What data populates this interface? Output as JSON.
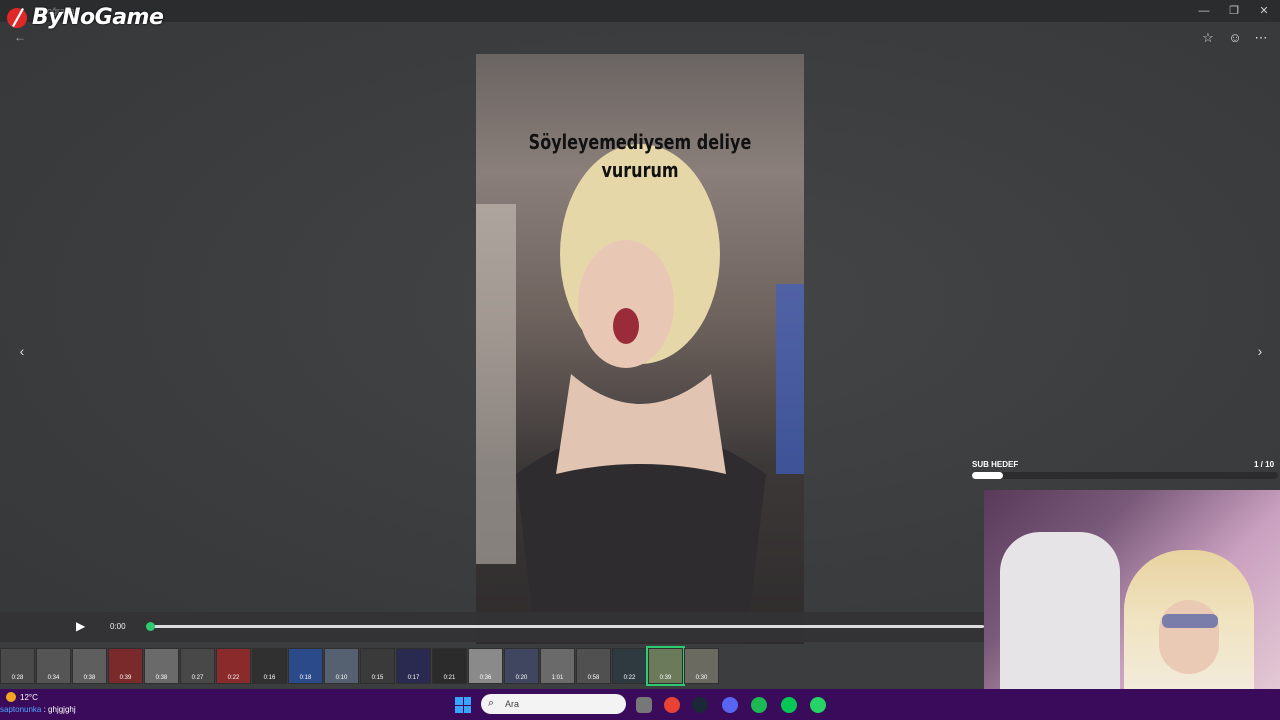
{
  "app": {
    "logo_text": "ByNoGame",
    "window_title": "Fotoğraflar"
  },
  "window_controls": {
    "minimize": "—",
    "restore": "❐",
    "close": "✕"
  },
  "viewer": {
    "back_icon": "arrow-left-icon",
    "top_icons": [
      "star-icon",
      "smiley-icon",
      "more-icon"
    ],
    "caption_line1": "Söyleyemediysem deliye",
    "caption_line2": "vururum",
    "prev_icon": "chevron-left-icon",
    "next_icon": "chevron-right-icon"
  },
  "player": {
    "time": "0:00",
    "progress": 0.0
  },
  "thumbnails": [
    "0:28",
    "0:34",
    "0:38",
    "0:39",
    "0:38",
    "0:27",
    "0:22",
    "0:16",
    "0:18",
    "0:10",
    "0:15",
    "0:17",
    "0:21",
    "0:36",
    "0:20",
    "1:01",
    "0:58",
    "0:22",
    "0:39",
    "0:30"
  ],
  "selected_thumbnail": 18,
  "overlay": {
    "sub_goal_label": "SUB HEDEF",
    "sub_goal_count": "1 / 10",
    "sub_goal_progress": 0.1
  },
  "taskbar": {
    "weather": "12°C",
    "search_placeholder": "Ara",
    "chat_user": "saptonunka",
    "chat_message": " : ghjgjghj",
    "apps": [
      "start-icon",
      "search-icon",
      "files-icon",
      "chrome-icon",
      "steam-icon",
      "discord-icon",
      "spotify-icon",
      "line-icon",
      "whatsapp-icon"
    ],
    "app_colors": [
      "#3aa3ff",
      "#555",
      "#777",
      "#e94235",
      "#1b2838",
      "#5865f2",
      "#1db954",
      "#06c755",
      "#25d366"
    ]
  }
}
